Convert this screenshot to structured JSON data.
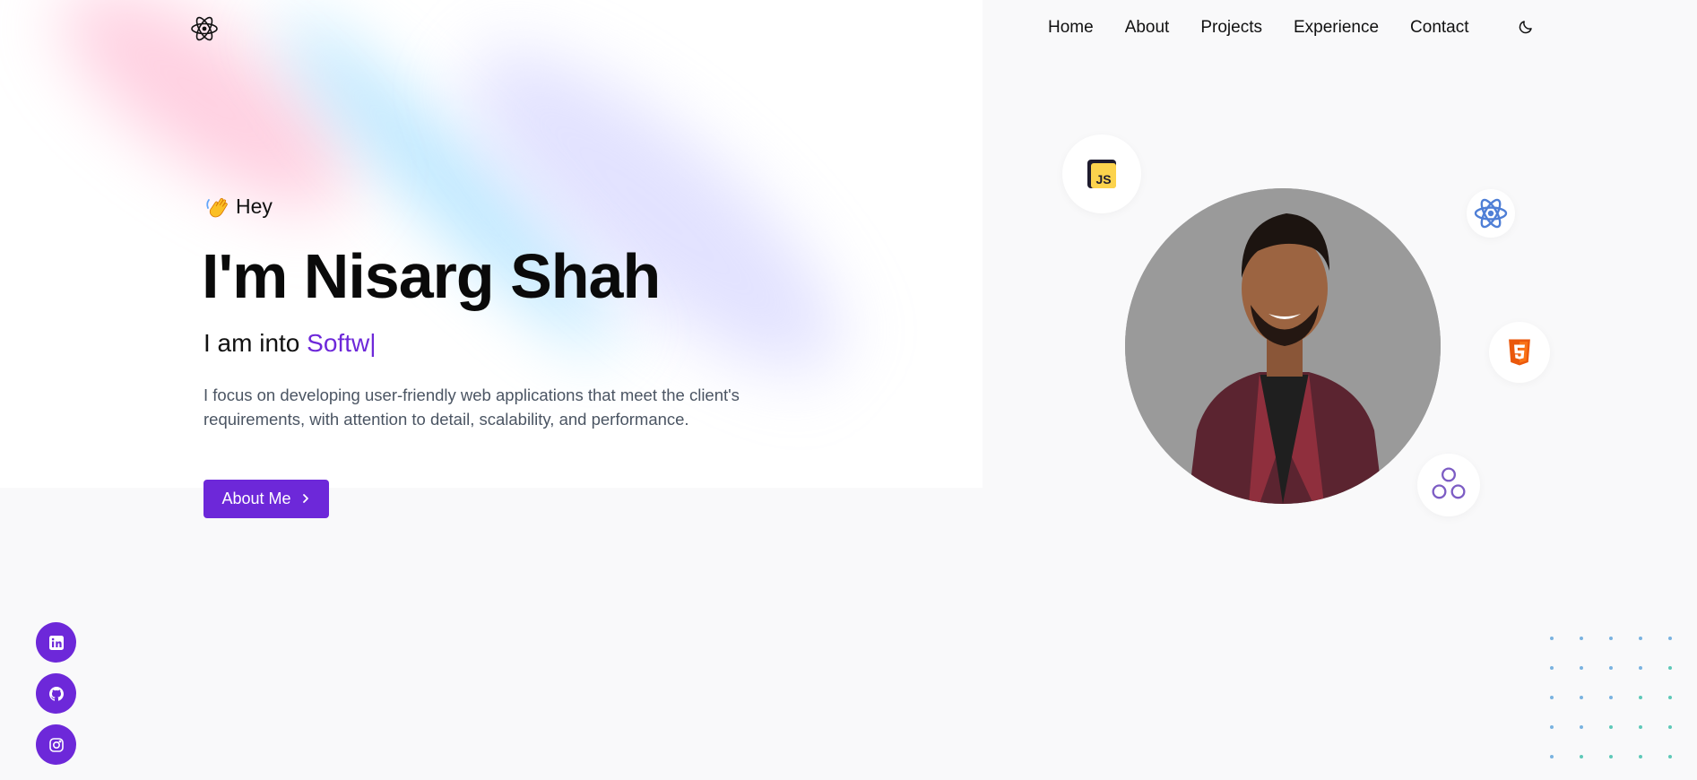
{
  "nav": {
    "logo_icon": "atom-icon",
    "links": [
      {
        "label": "Home"
      },
      {
        "label": "About"
      },
      {
        "label": "Projects"
      },
      {
        "label": "Experience"
      },
      {
        "label": "Contact"
      }
    ],
    "theme_icon": "moon-icon"
  },
  "hero": {
    "greeting_icon": "waving-hand-icon",
    "greeting": "Hey",
    "headline": "I'm Nisarg Shah",
    "role_prefix": "I am into ",
    "role_typed": "Softw",
    "role_cursor": "|",
    "intro": "I focus on developing user-friendly web applications that meet the client's requirements, with attention to detail, scalability, and performance.",
    "cta_label": "About Me",
    "cta_icon": "chevron-right-icon"
  },
  "tech_icons": [
    "javascript-icon",
    "react-icon",
    "html5-icon",
    "graphql-icon"
  ],
  "social": [
    "linkedin-icon",
    "github-icon",
    "instagram-icon"
  ],
  "colors": {
    "accent": "#6d28d9",
    "page_bg": "#f9f9fa",
    "hero_bg": "#ffffff",
    "text": "#111111",
    "muted": "#4b5563"
  }
}
